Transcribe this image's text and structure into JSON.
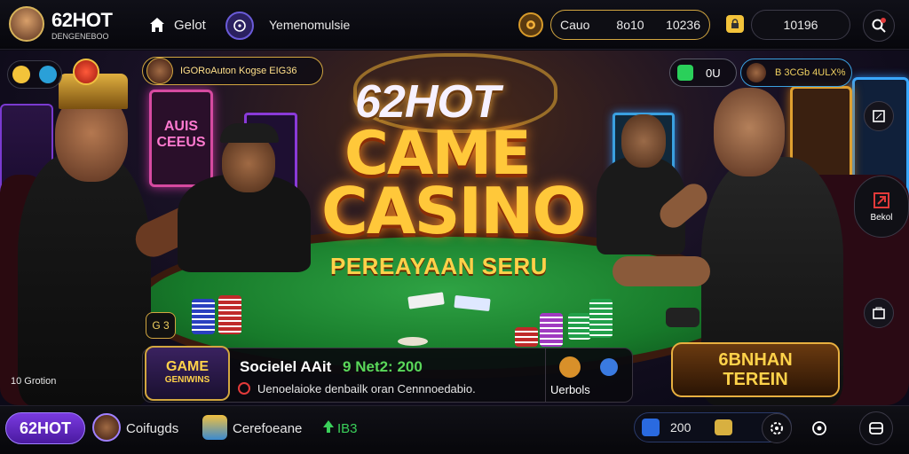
{
  "header": {
    "brand": "62HOT",
    "brand_sub": "DENGENEBOO",
    "nav_home_label": "Gelot",
    "nav_promo_label": "Yemenomulsie",
    "wallet": {
      "currency_label": "Cauo",
      "value_a": "8o10",
      "value_b": "10236"
    },
    "balance_value": "10196"
  },
  "hero": {
    "player_pill_text": "IGORoAuton Kogse EIG36",
    "counter_pill_value": "0U",
    "user_pill_text": "B 3CGb 4ULX%",
    "sign_left_text": "AUIS CEEUS",
    "logo_text": "62HOT",
    "title_line1": "CAME",
    "title_line2": "CASINO",
    "subtitle": "PEREAYAAN SERU",
    "side_button_label": "Bekol",
    "table_chip_label": "G 3",
    "corner_caption": "10 Grotion"
  },
  "promo_banner": {
    "badge_line1": "GAME",
    "badge_line2": "GENIWINS",
    "headline": "Socielel AAit",
    "headline_accent": "9 Net2: 200",
    "description": "Uenoelaioke denbailk oran Cennnoedabio.",
    "action_label": "Uerbols"
  },
  "bonus_badge": {
    "line1": "6BNHAN",
    "line2": "TEREIN"
  },
  "footer": {
    "brand_button": "62HOT",
    "item1_label": "Coifugds",
    "item2_label": "Cerefoeane",
    "item3_label": "IB3",
    "counter_value": "200"
  },
  "colors": {
    "accent_gold": "#ffc83a",
    "accent_purple": "#6a3ad8",
    "table_green": "#1e8a30",
    "neon_pink": "#d64aa0"
  }
}
